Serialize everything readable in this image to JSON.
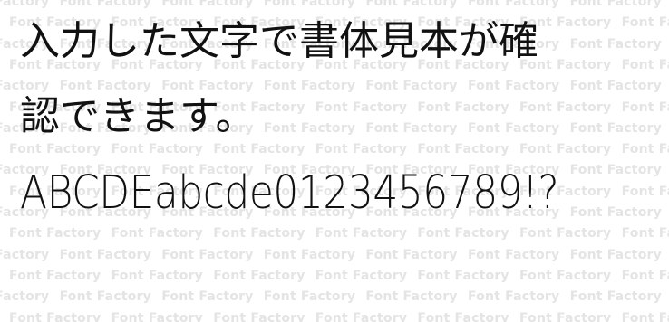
{
  "watermark": {
    "text": "Font Factory",
    "color": "#e4e4e4"
  },
  "sample": {
    "line1": "入力した文字で書体見本が確",
    "line2": "認できます。",
    "line3": "ABCDEabcde0123456789!?"
  }
}
